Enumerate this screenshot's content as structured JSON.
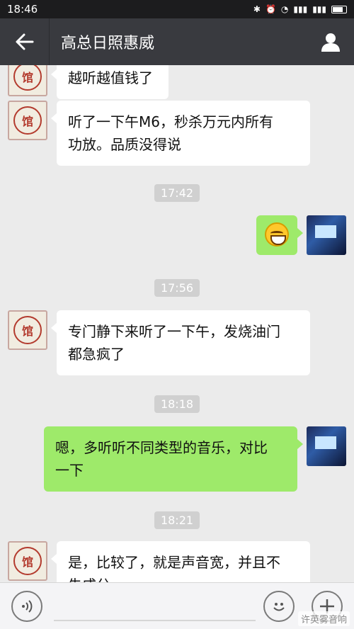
{
  "status_bar": {
    "time": "18:46",
    "icons": [
      "bluetooth-icon",
      "alarm-icon",
      "wifi-icon",
      "signal-icon",
      "signal-icon",
      "battery-icon"
    ]
  },
  "header": {
    "title": "高总日照惠威",
    "back_icon": "arrow-left-icon",
    "profile_icon": "person-icon"
  },
  "messages": [
    {
      "type": "text",
      "side": "left",
      "text": "越听越值钱了"
    },
    {
      "type": "text",
      "side": "left",
      "text_line1": "听了一下午M6，秒杀万元内所有",
      "text_line2": "功放。品质没得说"
    },
    {
      "type": "time",
      "text": "17:42"
    },
    {
      "type": "emoji",
      "side": "right",
      "emoji": "grinning-face-icon"
    },
    {
      "type": "time",
      "text": "17:56"
    },
    {
      "type": "text",
      "side": "left",
      "text_line1": "专门静下来听了一下午，发烧油门",
      "text_line2": "都急疯了"
    },
    {
      "type": "time",
      "text": "18:18"
    },
    {
      "type": "text",
      "side": "right",
      "text_line1": "嗯，多听听不同类型的音乐，对比",
      "text_line2": "一下"
    },
    {
      "type": "time",
      "text": "18:21"
    },
    {
      "type": "text",
      "side": "left",
      "text_line1": "是，比较了，就是声音宽，并且不",
      "text_line2": "失成分"
    }
  ],
  "bottom_bar": {
    "voice_icon": "voice-icon",
    "emoji_icon": "emoji-icon",
    "plus_icon": "plus-icon",
    "watermark": "许英雾音响"
  },
  "colors": {
    "header_bg": "#393a3f",
    "chat_bg": "#ebebeb",
    "bubble_me": "#9eea6a",
    "bubble_other": "#ffffff"
  }
}
